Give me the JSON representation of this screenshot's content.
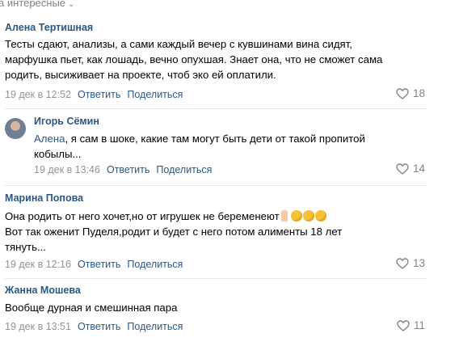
{
  "sort": {
    "label": "а интересные",
    "chevron_icon": "chevron-down-icon"
  },
  "comments": [
    {
      "author": "Алена Тертишная",
      "lines": [
        "Тесты сдают, анализы, а сами каждый вечер с кувшинами вина сидят,",
        "марфушка пьет, как лошадь, вечно опухшая. Знает она, что не сможет сама",
        "родить, высиживает на проекте, чтоб эко ей оплатили."
      ],
      "date": "19 дек в 12:52",
      "reply": "Ответить",
      "share": "Поделиться",
      "likes": "18"
    },
    {
      "author": "Игорь Сёмин",
      "lines": [
        "Алена, я сам в шоке, какие там могут быть дети от такой пропитой",
        "кобылы..."
      ],
      "reply_to": "Алена",
      "date": "19 дек в 13:46",
      "reply": "Ответить",
      "share": "Поделиться",
      "likes": "14"
    },
    {
      "author": "Марина Попова",
      "lines": [
        "Она родить от него хочет,но от игрушек не беременеют",
        "Вот так оженит Пуделя,родит и будет с него потом алименты 18 лет",
        "тянуть..."
      ],
      "date": "19 дек в 12:16",
      "reply": "Ответить",
      "share": "Поделиться",
      "likes": "13"
    },
    {
      "author": "Жанна Мошева",
      "lines": [
        "Вообще дурная и смешинная пара"
      ],
      "date": "19 дек в 13:51",
      "reply": "Ответить",
      "share": "Поделиться",
      "likes": "11"
    }
  ],
  "colors": {
    "link": "#2a5885",
    "meta": "#939393",
    "divider": "#e7e8ec"
  }
}
